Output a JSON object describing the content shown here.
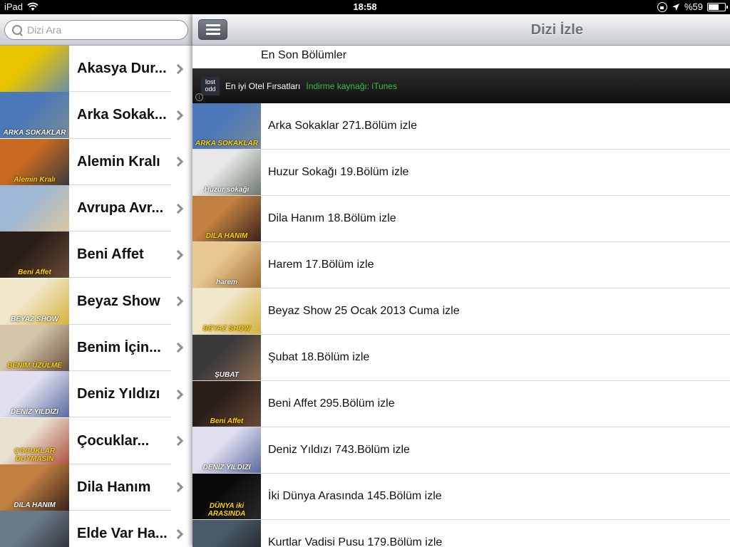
{
  "status_bar": {
    "device": "iPad",
    "time": "18:58",
    "battery": "%59",
    "icons": [
      "wifi-icon",
      "rotation-lock-icon",
      "location-icon",
      "battery-icon"
    ]
  },
  "sidebar": {
    "search_placeholder": "Dizi Ara",
    "items": [
      {
        "label": "Akasya Dur...",
        "thumb_colors": [
          "#e8c400",
          "#6b8fa8"
        ]
      },
      {
        "label": "Arka Sokak...",
        "thumb_colors": [
          "#4a78b8",
          "#7a8a9a"
        ],
        "thumb_caption": "ARKA SOKAKLAR"
      },
      {
        "label": "Alemin Kralı",
        "thumb_colors": [
          "#c96a20",
          "#3a3a3a"
        ],
        "thumb_caption": "Alemin Kralı"
      },
      {
        "label": "Avrupa Avr...",
        "thumb_colors": [
          "#9fb6d4",
          "#d8c8a0"
        ]
      },
      {
        "label": "Beni Affet",
        "thumb_colors": [
          "#2a1e18",
          "#6a4a3a"
        ],
        "thumb_caption": "Beni Affet"
      },
      {
        "label": "Beyaz Show",
        "thumb_colors": [
          "#f0e8c8",
          "#d8b040"
        ],
        "thumb_caption": "BEYAZ SHOW"
      },
      {
        "label": "Benim İçin...",
        "thumb_colors": [
          "#d4c4a8",
          "#6a5040"
        ],
        "thumb_caption": "BENİM ÜZÜLME"
      },
      {
        "label": "Deniz Yıldızı",
        "thumb_colors": [
          "#e0e0f0",
          "#5a6aa0"
        ],
        "thumb_caption": "DENİZ YILDIZI"
      },
      {
        "label": "Çocuklar...",
        "thumb_colors": [
          "#e8e0d0",
          "#b05040"
        ],
        "thumb_caption": "ÇOCUKLAR DUYMASIN"
      },
      {
        "label": "Dila Hanım",
        "thumb_colors": [
          "#c08040",
          "#3a2218"
        ],
        "thumb_caption": "DILA HANIM"
      },
      {
        "label": "Elde Var Ha...",
        "thumb_colors": [
          "#6a7a8a",
          "#2a2a2a"
        ]
      }
    ]
  },
  "main": {
    "title": "Dizi İzle",
    "section_header": "En Son Bölümler",
    "ad": {
      "logo_text": "lost odd",
      "text": "En iyi Otel Fırsatları",
      "source": "İndirme kaynağı: iTunes"
    },
    "episodes": [
      {
        "title": "Arka Sokaklar 271.Bölüm izle",
        "thumb_colors": [
          "#4a78b8",
          "#7a8a9a"
        ],
        "thumb_caption": "ARKA SOKAKLAR"
      },
      {
        "title": "Huzur Sokağı 19.Bölüm izle",
        "thumb_colors": [
          "#e8e8e8",
          "#6a7a6a"
        ],
        "thumb_caption": "Huzur sokağı"
      },
      {
        "title": "Dila Hanım 18.Bölüm izle",
        "thumb_colors": [
          "#c08040",
          "#3a2218"
        ],
        "thumb_caption": "DILA HANIM"
      },
      {
        "title": "Harem 17.Bölüm izle",
        "thumb_colors": [
          "#e8c890",
          "#a06a30"
        ],
        "thumb_caption": "harem"
      },
      {
        "title": "Beyaz Show 25 Ocak 2013 Cuma izle",
        "thumb_colors": [
          "#f0e8c8",
          "#d8b040"
        ],
        "thumb_caption": "BEYAZ SHOW"
      },
      {
        "title": "Şubat 18.Bölüm izle",
        "thumb_colors": [
          "#3a3a3a",
          "#8a6a50"
        ],
        "thumb_caption": "ŞUBAT"
      },
      {
        "title": "Beni Affet 295.Bölüm izle",
        "thumb_colors": [
          "#2a1e18",
          "#6a4a3a"
        ],
        "thumb_caption": "Beni Affet"
      },
      {
        "title": "Deniz Yıldızı 743.Bölüm izle",
        "thumb_colors": [
          "#e0e0f0",
          "#5a6aa0"
        ],
        "thumb_caption": "DENİZ YILDIZI"
      },
      {
        "title": "İki Dünya Arasında 145.Bölüm izle",
        "thumb_colors": [
          "#0a0a0a",
          "#2a2a2a"
        ],
        "thumb_caption": "DÜNYA iki ARASINDA"
      },
      {
        "title": "Kurtlar Vadisi Pusu 179.Bölüm izle",
        "thumb_colors": [
          "#4a5a6a",
          "#1a1a1a"
        ]
      }
    ]
  }
}
